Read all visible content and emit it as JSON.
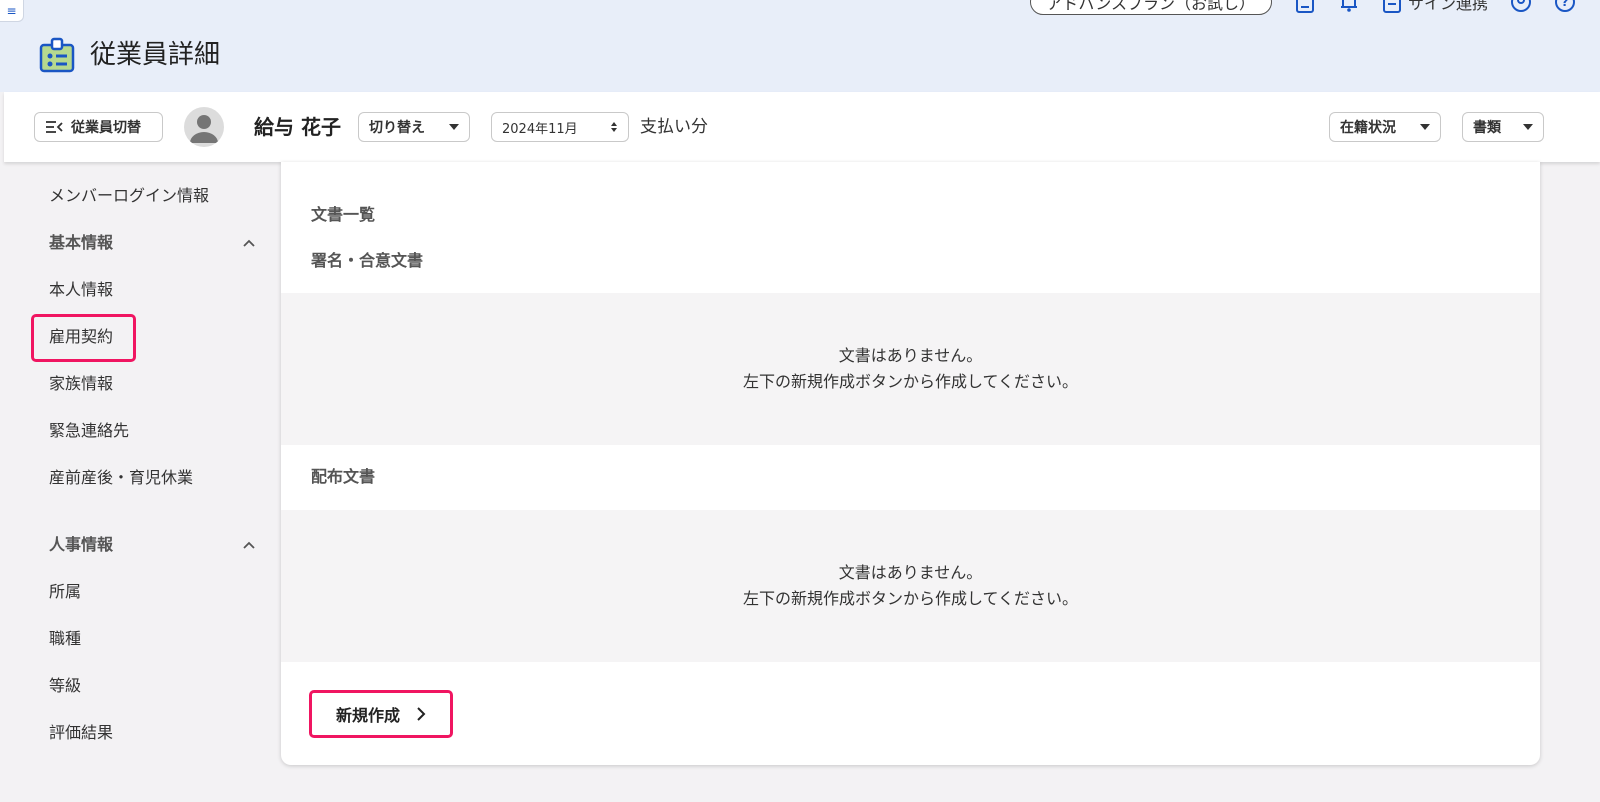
{
  "header": {
    "page_title": "従業員詳細",
    "plan_label": "アドバンスプラン（お試し）",
    "integration_label": "サイン連携",
    "icons": [
      "book-icon",
      "bell-icon",
      "document-icon",
      "account-circle-icon",
      "help-icon"
    ]
  },
  "employee_bar": {
    "switch_label": "従業員切替",
    "name": "給与 花子",
    "toggle_label": "切り替え",
    "month": "2024年11月",
    "pay_label": "支払い分",
    "status_label": "在籍状況",
    "docs_label": "書類"
  },
  "sidebar": {
    "login_info": "メンバーログイン情報",
    "basic_group": "基本情報",
    "basic_items": [
      "本人情報",
      "雇用契約",
      "家族情報",
      "緊急連絡先",
      "産前産後・育児休業"
    ],
    "hr_group": "人事情報",
    "hr_items": [
      "所属",
      "職種",
      "等級",
      "評価結果"
    ],
    "highlighted_item": "雇用契約"
  },
  "content": {
    "list_title": "文書一覧",
    "signed_section": "署名・合意文書",
    "distributed_section": "配布文書",
    "empty_line1": "文書はありません。",
    "empty_line2": "左下の新規作成ボタンから作成してください。",
    "new_button": "新規作成"
  },
  "colors": {
    "accent": "#f01561",
    "brand_blue": "#1a56c4",
    "topbar_bg": "#e8eef9",
    "panel_bg": "#f5f4f5"
  }
}
